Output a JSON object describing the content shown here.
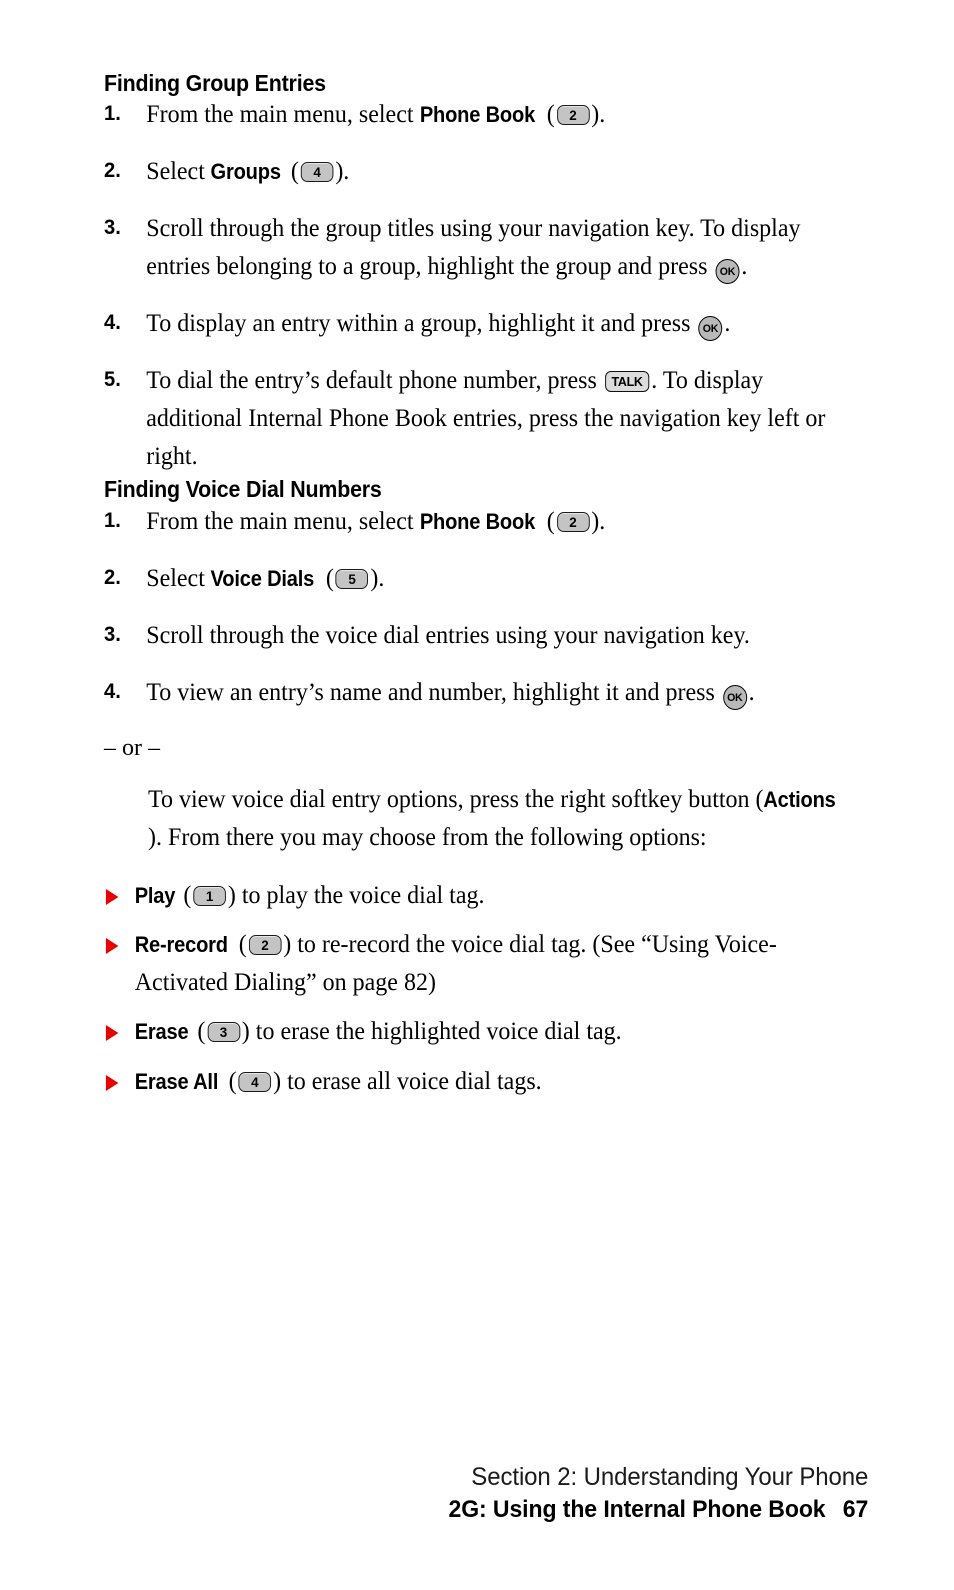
{
  "page": {
    "number": "67"
  },
  "sections": [
    {
      "heading": "Finding Group Entries",
      "steps": [
        {
          "num": "1.",
          "pre": "From the main menu, select ",
          "term": "Phone Book",
          "key": "2",
          "key_type": "number",
          "post": ""
        },
        {
          "num": "2.",
          "pre": "Select ",
          "term": "Groups",
          "key": "4",
          "key_type": "number",
          "post": ""
        },
        {
          "num": "3.",
          "text_a": "Scroll through the group titles using your navigation key. To display entries belonging to a group, highlight the group and press ",
          "key": "OK",
          "key_type": "ok",
          "text_b": "."
        },
        {
          "num": "4.",
          "text_a": "To display an entry within a group, highlight it and press ",
          "key": "OK",
          "key_type": "ok",
          "text_b": "."
        },
        {
          "num": "5.",
          "text_a": "To dial the entry’s default phone number, press ",
          "key": "TALK",
          "key_type": "talk",
          "text_b": ". To display additional Internal Phone Book entries, press the navigation key left or right."
        }
      ]
    },
    {
      "heading": "Finding Voice Dial Numbers",
      "steps": [
        {
          "num": "1.",
          "pre": "From the main menu, select ",
          "term": "Phone Book",
          "key": "2",
          "key_type": "number",
          "post": ""
        },
        {
          "num": "2.",
          "pre": "Select ",
          "term": "Voice Dials",
          "key": "5",
          "key_type": "number",
          "post": ""
        },
        {
          "num": "3.",
          "text_a": "Scroll through the voice dial entries using your navigation key.",
          "key": "",
          "key_type": "none",
          "text_b": ""
        },
        {
          "num": "4.",
          "text_a": "To view an entry’s name and number, highlight it and press ",
          "key": "OK",
          "key_type": "ok",
          "text_b": "."
        }
      ]
    }
  ],
  "or_separator": "– or –",
  "options_intro": {
    "part_a": "To view voice dial entry options, press the right softkey button (",
    "bold_term": "Actions",
    "part_b": "). From there you may choose from the following options:"
  },
  "bullets": [
    {
      "term": "Play",
      "key": "1",
      "text": ") to play the voice dial tag."
    },
    {
      "term": "Re-record",
      "key": "2",
      "text": ") to re-record the voice dial tag. (See “Using Voice-Activated Dialing” on page 82)"
    },
    {
      "term": "Erase",
      "key": "3",
      "text": ") to erase the highlighted voice dial tag."
    },
    {
      "term": "Erase All",
      "key": "4",
      "text": ") to erase all voice dial tags."
    }
  ],
  "bullet_open_paren": "(",
  "footer": {
    "line1": "Section 2: Understanding Your Phone",
    "line2": "2G: Using the Internal Phone Book",
    "page_number": "67"
  },
  "colors": {
    "bullet_red": "#e60000",
    "key_fill": "#c4c4c4",
    "text": "#000000"
  }
}
